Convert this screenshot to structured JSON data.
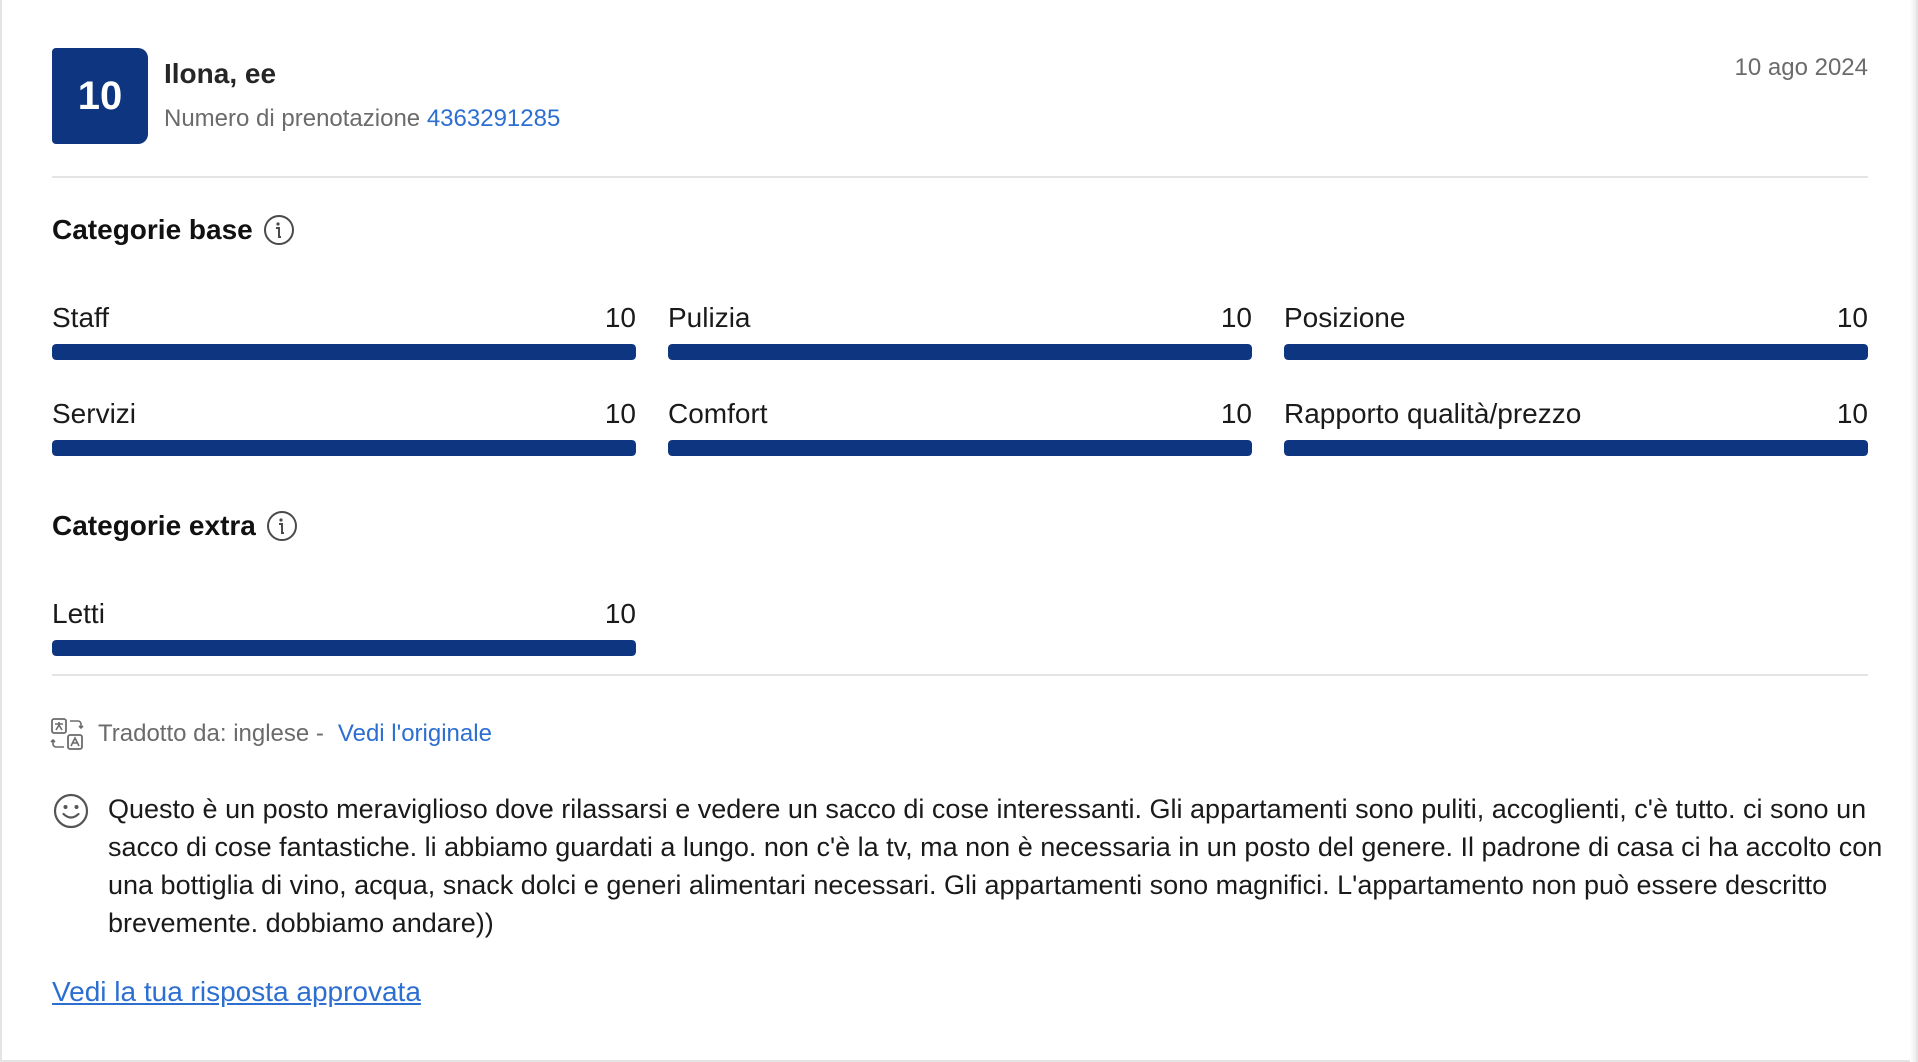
{
  "review": {
    "score": "10",
    "guest_name": "Ilona, ee",
    "booking_label": "Numero di prenotazione",
    "booking_number": "4363291285",
    "date": "10 ago 2024"
  },
  "base_categories": {
    "title": "Categorie base",
    "items": [
      {
        "label": "Staff",
        "score": "10",
        "fraction": 1.0
      },
      {
        "label": "Pulizia",
        "score": "10",
        "fraction": 1.0
      },
      {
        "label": "Posizione",
        "score": "10",
        "fraction": 1.0
      },
      {
        "label": "Servizi",
        "score": "10",
        "fraction": 1.0
      },
      {
        "label": "Comfort",
        "score": "10",
        "fraction": 1.0
      },
      {
        "label": "Rapporto qualità/prezzo",
        "score": "10",
        "fraction": 1.0
      }
    ]
  },
  "extra_categories": {
    "title": "Categorie extra",
    "items": [
      {
        "label": "Letti",
        "score": "10",
        "fraction": 1.0
      }
    ]
  },
  "translation": {
    "label": "Tradotto da: inglese -",
    "link": "Vedi l'originale"
  },
  "comment": {
    "text": "Questo è un posto meraviglioso dove rilassarsi e vedere un sacco di cose interessanti. Gli appartamenti sono puliti, accoglienti, c'è tutto. ci sono un sacco di cose fantastiche. li abbiamo guardati a lungo. non c'è la tv, ma non è necessaria in un posto del genere. Il padrone di casa ci ha accolto con una bottiglia di vino, acqua, snack dolci e generi alimentari necessari. Gli appartamenti sono magnifici. L'appartamento non può essere descritto brevemente. dobbiamo andare))"
  },
  "response_link": "Vedi la tua risposta approvata",
  "colors": {
    "brand": "#0d3580",
    "link": "#2c6fd1",
    "muted": "#6b6b6b"
  },
  "icons": {
    "info": "info-icon",
    "translate": "translate-icon",
    "smile": "smile-icon"
  }
}
